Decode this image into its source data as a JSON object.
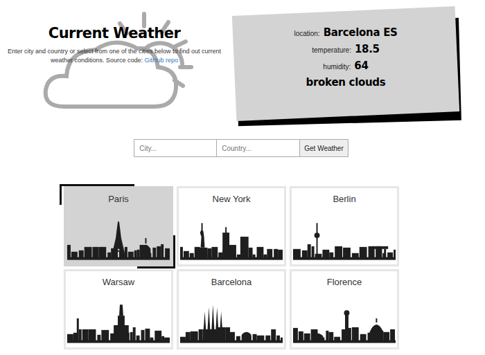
{
  "header": {
    "title": "Current Weather",
    "description": "Enter city and country or select from one of the cities below to find out current weather conditions. Source code: ",
    "link": "GitHub repo"
  },
  "weather": {
    "location_label": "location:",
    "location": "Barcelona ES",
    "temperature_label": "temperature:",
    "temperature": "18.5",
    "humidity_label": "humidity:",
    "humidity": "64",
    "description": "broken clouds"
  },
  "search": {
    "city_placeholder": "City...",
    "country_placeholder": "Country...",
    "button": "Get Weather"
  },
  "cities": [
    {
      "name": "Paris",
      "selected": true
    },
    {
      "name": "New York",
      "selected": false
    },
    {
      "name": "Berlin",
      "selected": false
    },
    {
      "name": "Warsaw",
      "selected": false
    },
    {
      "name": "Barcelona",
      "selected": false
    },
    {
      "name": "Florence",
      "selected": false
    }
  ]
}
